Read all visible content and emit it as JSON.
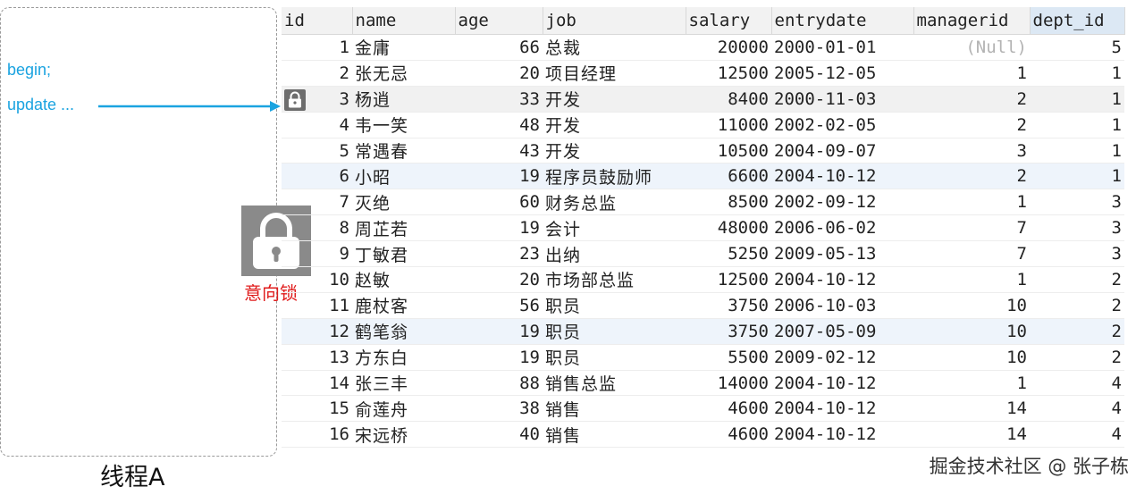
{
  "thread": {
    "label": "线程A",
    "code_lines": [
      "begin;",
      "update ..."
    ]
  },
  "intention_lock": {
    "label": "意向锁",
    "icon": "padlock-icon"
  },
  "row_lock_icon": "padlock-icon",
  "table": {
    "columns": [
      "id",
      "name",
      "age",
      "job",
      "salary",
      "entrydate",
      "managerid",
      "dept_id"
    ],
    "selected_column": "dept_id",
    "rows": [
      {
        "id": "1",
        "name": "金庸",
        "age": "66",
        "job": "总裁",
        "salary": "20000",
        "entrydate": "2000-01-01",
        "managerid": "(Null)",
        "dept_id": "5"
      },
      {
        "id": "2",
        "name": "张无忌",
        "age": "20",
        "job": "项目经理",
        "salary": "12500",
        "entrydate": "2005-12-05",
        "managerid": "1",
        "dept_id": "1"
      },
      {
        "id": "3",
        "name": "杨逍",
        "age": "33",
        "job": "开发",
        "salary": "8400",
        "entrydate": "2000-11-03",
        "managerid": "2",
        "dept_id": "1",
        "locked": true
      },
      {
        "id": "4",
        "name": "韦一笑",
        "age": "48",
        "job": "开发",
        "salary": "11000",
        "entrydate": "2002-02-05",
        "managerid": "2",
        "dept_id": "1"
      },
      {
        "id": "5",
        "name": "常遇春",
        "age": "43",
        "job": "开发",
        "salary": "10500",
        "entrydate": "2004-09-07",
        "managerid": "3",
        "dept_id": "1"
      },
      {
        "id": "6",
        "name": "小昭",
        "age": "19",
        "job": "程序员鼓励师",
        "salary": "6600",
        "entrydate": "2004-10-12",
        "managerid": "2",
        "dept_id": "1"
      },
      {
        "id": "7",
        "name": "灭绝",
        "age": "60",
        "job": "财务总监",
        "salary": "8500",
        "entrydate": "2002-09-12",
        "managerid": "1",
        "dept_id": "3"
      },
      {
        "id": "8",
        "name": "周芷若",
        "age": "19",
        "job": "会计",
        "salary": "48000",
        "entrydate": "2006-06-02",
        "managerid": "7",
        "dept_id": "3"
      },
      {
        "id": "9",
        "name": "丁敏君",
        "age": "23",
        "job": "出纳",
        "salary": "5250",
        "entrydate": "2009-05-13",
        "managerid": "7",
        "dept_id": "3"
      },
      {
        "id": "10",
        "name": "赵敏",
        "age": "20",
        "job": "市场部总监",
        "salary": "12500",
        "entrydate": "2004-10-12",
        "managerid": "1",
        "dept_id": "2"
      },
      {
        "id": "11",
        "name": "鹿杖客",
        "age": "56",
        "job": "职员",
        "salary": "3750",
        "entrydate": "2006-10-03",
        "managerid": "10",
        "dept_id": "2"
      },
      {
        "id": "12",
        "name": "鹤笔翁",
        "age": "19",
        "job": "职员",
        "salary": "3750",
        "entrydate": "2007-05-09",
        "managerid": "10",
        "dept_id": "2"
      },
      {
        "id": "13",
        "name": "方东白",
        "age": "19",
        "job": "职员",
        "salary": "5500",
        "entrydate": "2009-02-12",
        "managerid": "10",
        "dept_id": "2"
      },
      {
        "id": "14",
        "name": "张三丰",
        "age": "88",
        "job": "销售总监",
        "salary": "14000",
        "entrydate": "2004-10-12",
        "managerid": "1",
        "dept_id": "4"
      },
      {
        "id": "15",
        "name": "俞莲舟",
        "age": "38",
        "job": "销售",
        "salary": "4600",
        "entrydate": "2004-10-12",
        "managerid": "14",
        "dept_id": "4"
      },
      {
        "id": "16",
        "name": "宋远桥",
        "age": "40",
        "job": "销售",
        "salary": "4600",
        "entrydate": "2004-10-12",
        "managerid": "14",
        "dept_id": "4"
      }
    ]
  },
  "colors": {
    "code": "#1aa3e0",
    "lock_label": "#e01c1c",
    "alt_row": "#eef4fb",
    "null_text": "#b3b3b3"
  },
  "watermark": "掘金技术社区 @ 张子栋"
}
